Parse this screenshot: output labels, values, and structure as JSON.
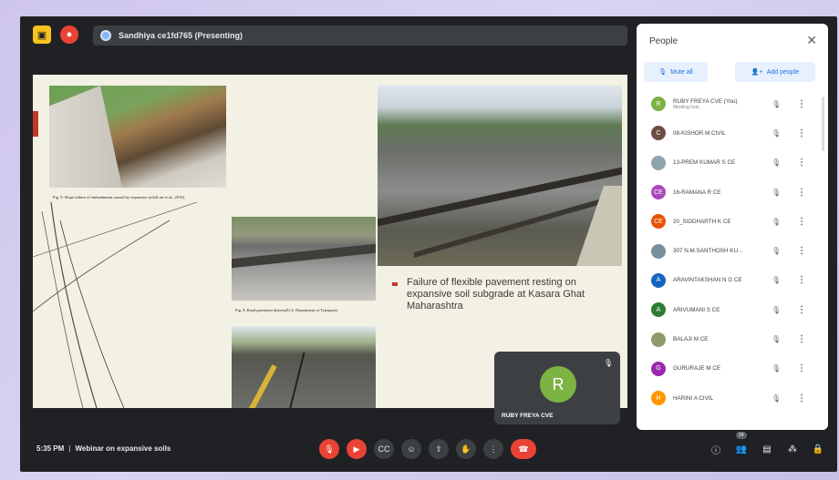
{
  "presentation": {
    "presenter_label": "Sandhiya ce1fd765 (Presenting)"
  },
  "slide": {
    "caption_1": "Fig. 9. Slope failure of embankment caused by expansive soils(Latt et al., 2019).",
    "caption_2": "Fig. 8. Road pavement distress(U.S. Department of Transport)",
    "bullet": "Failure of flexible pavement resting on expansive soil subgrade at Kasara Ghat Maharashtra"
  },
  "self_tile": {
    "initial": "R",
    "name": "RUBY FREYA CVE",
    "avatar_color": "#7cb342"
  },
  "people_panel": {
    "title": "People",
    "mute_all_label": "Mute all",
    "add_people_label": "Add people",
    "participants": [
      {
        "initial": "R",
        "name": "RUBY FREYA CVE (You)",
        "subtitle": "Meeting host",
        "color": "#7cb342",
        "mic_icon": "mic-off-icon"
      },
      {
        "initial": "C",
        "name": "08-KISHOR M CIVIL",
        "subtitle": "",
        "color": "#6d4c41",
        "mic_icon": "mic-off-icon"
      },
      {
        "initial": "",
        "name": "13-PREM KUMAR S CE",
        "subtitle": "",
        "color": "#90a4ae",
        "mic_icon": "mic-off-icon"
      },
      {
        "initial": "CE",
        "name": "16-RAMANA R CE",
        "subtitle": "",
        "color": "#ab47bc",
        "mic_icon": "mic-off-icon"
      },
      {
        "initial": "CE",
        "name": "20_SIDDHARTH K CE",
        "subtitle": "",
        "color": "#e65100",
        "mic_icon": "mic-off-icon"
      },
      {
        "initial": "",
        "name": "307 N.M.SANTHOSH KU...",
        "subtitle": "",
        "color": "#78909c",
        "mic_icon": "mic-off-icon"
      },
      {
        "initial": "A",
        "name": "ARAVINTAKSHAN N G CE",
        "subtitle": "",
        "color": "#1565c0",
        "mic_icon": "mic-off-icon"
      },
      {
        "initial": "A",
        "name": "ARIVUMANI S CE",
        "subtitle": "",
        "color": "#2e7d32",
        "mic_icon": "mic-off-icon"
      },
      {
        "initial": "",
        "name": "BALAJI M CE",
        "subtitle": "",
        "color": "#8d9b6a",
        "mic_icon": "mic-off-icon"
      },
      {
        "initial": "G",
        "name": "GURURAJE M CE",
        "subtitle": "",
        "color": "#9c27b0",
        "mic_icon": "mic-off-icon"
      },
      {
        "initial": "H",
        "name": "HARINI A CIVIL",
        "subtitle": "",
        "color": "#ff9800",
        "mic_icon": "mic-off-icon"
      }
    ]
  },
  "bottom_bar": {
    "time": "5:35 PM",
    "meeting_title": "Webinar on expansive soils",
    "participant_count": "24"
  },
  "colors": {
    "background": "#202124",
    "accent_red": "#ea4335",
    "accent_blue": "#1a73e8"
  }
}
